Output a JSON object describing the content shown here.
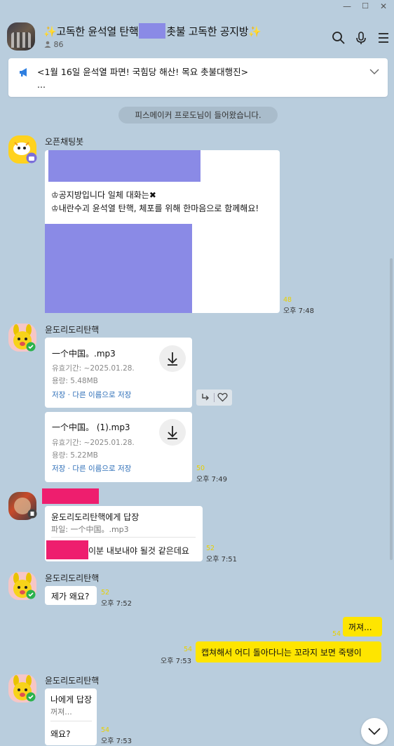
{
  "window": {
    "minimize": "—",
    "maximize": "☐",
    "close": "✕"
  },
  "header": {
    "title_left": "✨고독한 윤석열 탄핵",
    "title_right": "촛불 고독한 공지방✨",
    "members": "86"
  },
  "notice": {
    "text": "<1월 16일 윤석열 파면! 국힘당 해산! 목요 촛불대행진>",
    "more": "..."
  },
  "system_message": "피스메이커 프로도님이 들어왔습니다.",
  "messages": [
    {
      "sender": "오픈채팅봇",
      "line1": "♔공지방입니다 일체 대화는✖",
      "line2": "♔내란수괴 윤석열 탄핵, 체포를 위해 한마음으로 함께해요!",
      "unread": "48",
      "time": "오후 7:48"
    },
    {
      "sender": "윤도리도리탄핵",
      "files": [
        {
          "name": "一个中国。.mp3",
          "expiry": "유효기간: ~2025.01.28.",
          "size": "용량: 5.48MB",
          "actions": "저장 · 다른 이름으로 저장"
        },
        {
          "name": "一个中国。 (1).mp3",
          "expiry": "유효기간: ~2025.01.28.",
          "size": "용량: 5.22MB",
          "actions": "저장 · 다른 이름으로 저장"
        }
      ],
      "unread": "50",
      "time": "오후 7:49"
    },
    {
      "reply_to": "윤도리도리탄핵에게 답장",
      "reply_ref": "파일: 一个中国。.mp3",
      "text": "이분 내보내야 될것 같은데요",
      "unread": "52",
      "time": "오후 7:51"
    },
    {
      "sender": "윤도리도리탄핵",
      "text": "제가 왜요?",
      "unread": "52",
      "time": "오후 7:52"
    },
    {
      "mine": true,
      "text": "꺼져...",
      "unread": "54"
    },
    {
      "mine": true,
      "text": "캡쳐해서 어디 돌아다니는 꼬라지 보면 죽탱이",
      "unread": "54",
      "time": "오후 7:53"
    },
    {
      "sender": "윤도리도리탄핵",
      "reply_to": "나에게 답장",
      "reply_ref": "꺼져...",
      "text": "왜요?",
      "unread": "54",
      "time": "오후 7:53"
    }
  ]
}
